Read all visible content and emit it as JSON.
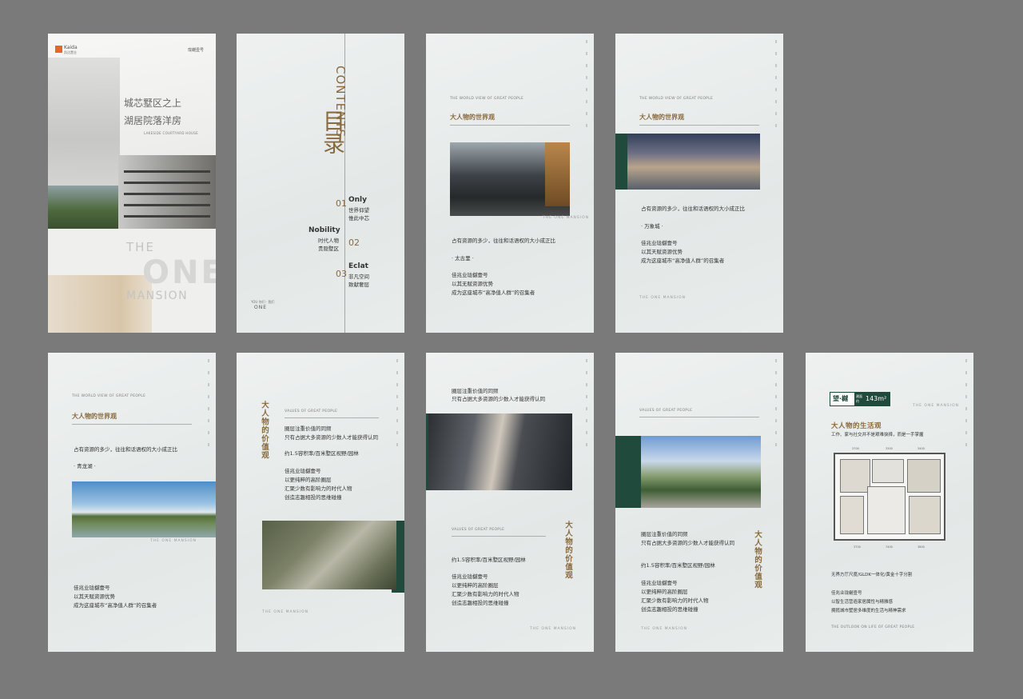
{
  "cover": {
    "brand_en": "Kaida",
    "brand_cn": "凯达置业",
    "partner": "珑樾壹号",
    "title_line1": "城芯墅区之上",
    "title_line2": "湖居院落洋房",
    "subtitle": "LAKESIDE COURTYARD HOUSE",
    "the": "THE",
    "one": "ONE",
    "mansion": "MANSION"
  },
  "toc": {
    "title_en": "CONTENTS",
    "title_cn": "目录",
    "items": [
      {
        "no": "01",
        "word": "Only",
        "cn1": "世界仰望",
        "cn2": "惟此中芯"
      },
      {
        "no": "02",
        "word": "Nobility",
        "cn1": "时代人物",
        "cn2": "贵隐墅区"
      },
      {
        "no": "03",
        "word": "Eclat",
        "cn1": "非凡空间",
        "cn2": "致献奢层"
      }
    ],
    "footer_small": "YOU 你们 · 我们",
    "footer_one": "ONE"
  },
  "common": {
    "world_view_en": "THE WORLD VIEW OF GREAT PEOPLE",
    "world_view_cn": "大人物的世界观",
    "values_en": "VALUES OF GREAT PEOPLE",
    "values_cn": "大人物的价值观",
    "mansion_caption": "THE ONE MANSION",
    "life_cn": "大人物的生活观",
    "life_en": "THE OUTLOOK ON LIFE OF GREAT PEOPLE"
  },
  "p3": {
    "line1": "占有资源的多少，往往和话语权的大小成正比",
    "tag": "· 太古里 ·",
    "b1": "佳兆业珑樾壹号",
    "b2": "以其无赋资源优势",
    "b3": "成为这座城市“高净值人群”的召集者"
  },
  "p4": {
    "line1": "占有资源的多少，往往和话语权的大小成正比",
    "tag": "· 万象城 ·",
    "b1": "佳兆业珑樾壹号",
    "b2": "以其天赋资源优势",
    "b3": "成为这座城市“高净值人群”的召集者"
  },
  "p5": {
    "line1": "占有资源的多少，往往和话语权的大小成正比",
    "tag": "· 青龙湖 ·",
    "b1": "佳兆业珑樾壹号",
    "b2": "以其天赋资源优势",
    "b3": "成为这座城市“高净值人群”的召集者"
  },
  "p6": {
    "l1": "圈层注重价值的同频",
    "l2": "只有占据大多资源的少数人才能获得认同",
    "l3": "约1.5容积率/百米墅区视野/园林",
    "l4": "佳兆业珑樾壹号",
    "l5": "以更纯粹的高阶圈层",
    "l6": "汇聚少数有影响力的时代人物",
    "l7": "创造志趣相投的思维碰撞"
  },
  "p7": {
    "l1": "圈层注重价值的同频",
    "l2": "只有占据大多资源的少数人才能获得认同",
    "l3": "约1.5容积率/百米墅区视野/园林",
    "l4": "佳兆业珑樾壹号",
    "l5": "以更纯粹的高阶圈层",
    "l6": "汇聚少数有影响力的时代人物",
    "l7": "创造志趣相投的思维碰撞"
  },
  "p8": {
    "l1": "圈层注重价值的同频",
    "l2": "只有占据大多资源的少数人才能获得认同",
    "l3": "约1.5容积率/百米墅区视野/园林",
    "l4": "佳兆业珑樾壹号",
    "l5": "以更纯粹的高阶圈层",
    "l6": "汇聚少数有影响力的时代人物",
    "l7": "创造志趣相投的思维碰撞"
  },
  "p9": {
    "badge_name": "望·樾",
    "badge_tag1": "建面",
    "badge_tag2": "约",
    "area": "143m²",
    "sub": "工作、家与社交并不是艰难抉择，而是一手掌握",
    "dims": [
      "3700",
      "3300",
      "3400",
      "3500",
      "3700",
      "7400",
      "3800"
    ],
    "f1": "无界方厅尺度/GLDK一体化/黄金十字分割",
    "f2": "佳兆业珑樾壹号",
    "f3": "以智生活营造家居属性与精雅感",
    "f4": "拥揽城市墅居多维度的生活与精神需求"
  },
  "colors": {
    "gold": "#8a6a3f",
    "green": "#1f4a3c",
    "background": "#7a7a7a"
  }
}
